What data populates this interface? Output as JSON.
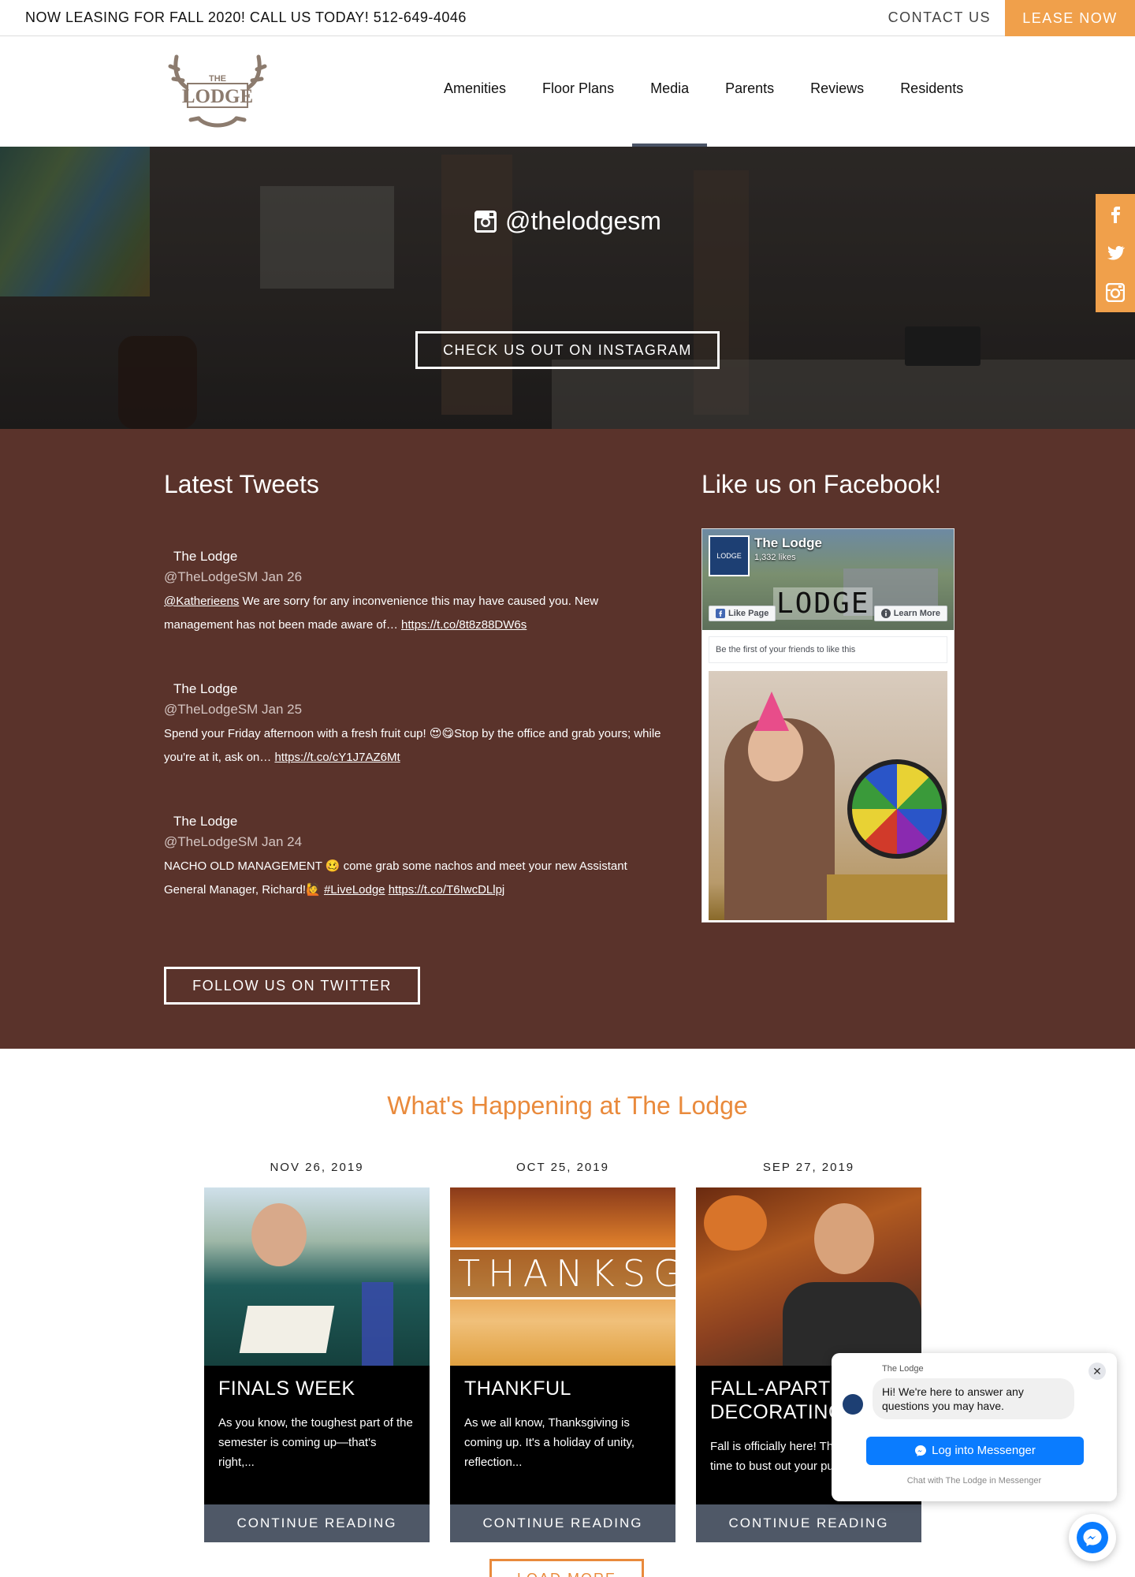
{
  "topbar": {
    "promo": "NOW LEASING FOR FALL 2020! CALL US TODAY! 512-649-4046",
    "contact_label": "CONTACT US",
    "lease_label": "LEASE NOW",
    "lease_color": "#f0a04b"
  },
  "logo": {
    "top_word": "THE",
    "main_word": "LODGE"
  },
  "nav": {
    "items": [
      {
        "label": "Amenities"
      },
      {
        "label": "Floor Plans"
      },
      {
        "label": "Media"
      },
      {
        "label": "Parents"
      },
      {
        "label": "Reviews"
      },
      {
        "label": "Residents"
      }
    ],
    "active": "Media"
  },
  "hero": {
    "handle": "@thelodgesm",
    "button_label": "CHECK US OUT ON INSTAGRAM"
  },
  "social": {
    "icons": [
      "facebook-icon",
      "twitter-icon",
      "instagram-icon"
    ]
  },
  "tweets": {
    "title": "Latest Tweets",
    "items": [
      {
        "name": "The Lodge",
        "handle_date": "@TheLodgeSM Jan 26",
        "mention": "@Katherieens",
        "text": " We are sorry for any inconvenience this may have caused you. New management has not been made aware of… ",
        "link": "https://t.co/8t8z88DW6s"
      },
      {
        "name": "The Lodge",
        "handle_date": "@TheLodgeSM Jan 25",
        "text": "Spend your Friday afternoon with a fresh fruit cup! 😍😋Stop by the office and grab yours; while you're at it, ask on… ",
        "link": "https://t.co/cY1J7AZ6Mt"
      },
      {
        "name": "The Lodge",
        "handle_date": "@TheLodgeSM Jan 24",
        "text": "NACHO OLD MANAGEMENT 🥴 come grab some nachos and meet your new Assistant General Manager, Richard!🙋 ",
        "hashtag": "#LiveLodge",
        "link": "https://t.co/T6IwcDLlpj"
      }
    ],
    "button_label": "FOLLOW US ON TWITTER"
  },
  "facebook": {
    "title": "Like us on Facebook!",
    "page_name": "The Lodge",
    "likes": "1,332 likes",
    "avatar_text": "LODGE",
    "cover_text": "LODGE",
    "like_label": "Like Page",
    "learn_label": "Learn More",
    "friends_text": "Be the first of your friends to like this"
  },
  "happening": {
    "title": "What's Happening at The Lodge",
    "title_color": "#e98a3c",
    "posts": [
      {
        "date": "NOV 26, 2019",
        "title": "FINALS WEEK",
        "excerpt": "As you know, the toughest part of the semester is coming up—that's right,...",
        "button": "CONTINUE READING"
      },
      {
        "date": "OCT 25, 2019",
        "title": "THANKFUL",
        "image_text": "THANKSGIVING",
        "excerpt": "As we all know, Thanksgiving is coming up. It's a holiday of unity, reflection...",
        "button": "CONTINUE READING"
      },
      {
        "date": "SEP 27, 2019",
        "title": "FALL-APARTMENT DECORATING",
        "excerpt": "Fall is officially here! That means it's time to bust out your pumpkin spice...",
        "button": "CONTINUE READING"
      }
    ],
    "load_more": "LOAD MORE"
  },
  "messenger": {
    "page_name": "The Lodge",
    "greeting": "Hi! We're here to answer any questions you may have.",
    "button": "Log into Messenger",
    "footer": "Chat with The Lodge in Messenger"
  }
}
